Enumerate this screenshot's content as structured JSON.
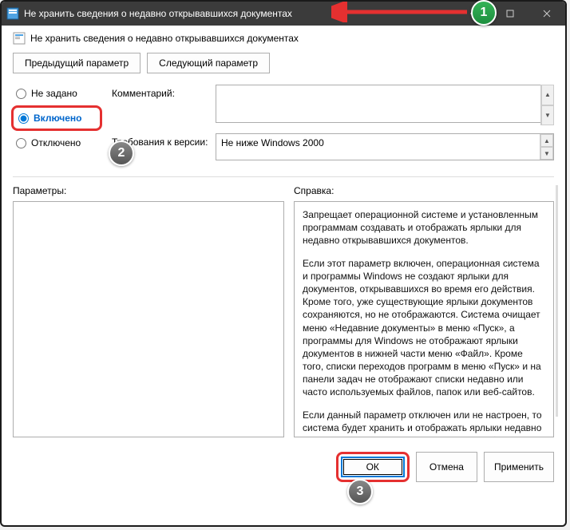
{
  "titlebar": {
    "title": "Не хранить сведения о недавно открывавшихся документах"
  },
  "header": {
    "title": "Не хранить сведения о недавно открывавшихся документах"
  },
  "nav": {
    "prev": "Предыдущий параметр",
    "next": "Следующий параметр"
  },
  "radios": {
    "not_configured": "Не задано",
    "enabled": "Включено",
    "disabled": "Отключено"
  },
  "fields": {
    "comment_label": "Комментарий:",
    "comment_value": "",
    "version_label": "Требования к версии:",
    "version_value": "Не ниже Windows 2000"
  },
  "sections": {
    "params": "Параметры:",
    "help": "Справка:"
  },
  "help": {
    "p1": "Запрещает операционной системе и установленным программам создавать и отображать ярлыки для недавно открывавшихся документов.",
    "p2": "Если этот параметр включен, операционная система и программы Windows не создают ярлыки для документов, открывавшихся во время его действия. Кроме того, уже существующие ярлыки документов сохраняются, но не отображаются. Система очищает меню «Недавние документы» в меню «Пуск», а программы для Windows не отображают ярлыки документов в нижней части меню «Файл». Кроме того, списки переходов программ в меню «Пуск» и на панели задач не отображают списки недавно или часто используемых файлов, папок или веб-сайтов.",
    "p3": "Если данный параметр отключен или не настроен, то система будет хранить и отображать ярлыки недавно и часто используемых файлов, папок и веб-сайтов."
  },
  "footer": {
    "ok": "ОК",
    "cancel": "Отмена",
    "apply": "Применить"
  },
  "callouts": {
    "c1": "1",
    "c2": "2",
    "c3": "3"
  }
}
